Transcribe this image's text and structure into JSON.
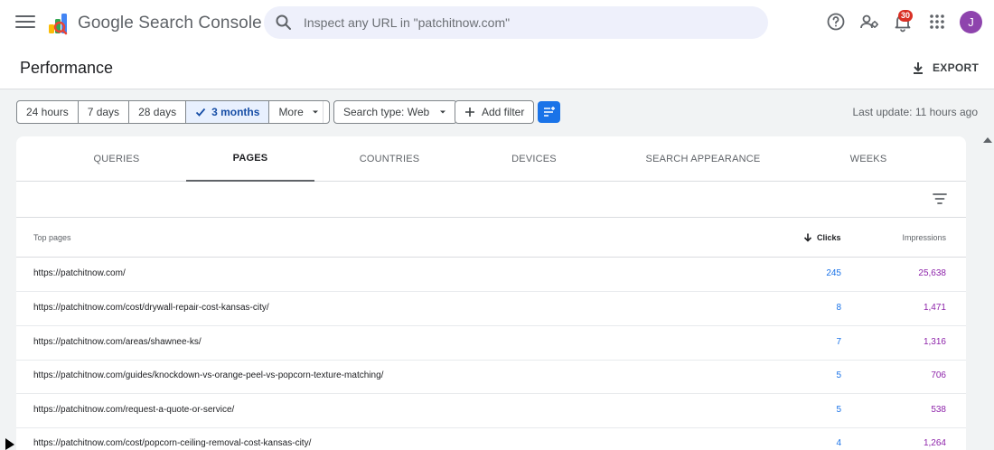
{
  "app": {
    "product_name": "Google Search Console",
    "search_placeholder": "Inspect any URL in \"patchitnow.com\"",
    "notification_count": "30",
    "avatar_initial": "J"
  },
  "header": {
    "title": "Performance",
    "export_label": "EXPORT"
  },
  "filters": {
    "date_ranges": [
      {
        "label": "24 hours",
        "selected": false
      },
      {
        "label": "7 days",
        "selected": false
      },
      {
        "label": "28 days",
        "selected": false
      },
      {
        "label": "3 months",
        "selected": true
      },
      {
        "label": "More",
        "selected": false
      }
    ],
    "search_type": "Search type: Web",
    "add_filter": "Add filter",
    "last_update": "Last update: 11 hours ago"
  },
  "tabs": [
    "QUERIES",
    "PAGES",
    "COUNTRIES",
    "DEVICES",
    "SEARCH APPEARANCE",
    "WEEKS"
  ],
  "active_tab": "PAGES",
  "table": {
    "columns": [
      "Top pages",
      "Clicks",
      "Impressions"
    ],
    "rows": [
      {
        "url": "https://patchitnow.com/",
        "clicks": "245",
        "impressions": "25,638"
      },
      {
        "url": "https://patchitnow.com/cost/drywall-repair-cost-kansas-city/",
        "clicks": "8",
        "impressions": "1,471"
      },
      {
        "url": "https://patchitnow.com/areas/shawnee-ks/",
        "clicks": "7",
        "impressions": "1,316"
      },
      {
        "url": "https://patchitnow.com/guides/knockdown-vs-orange-peel-vs-popcorn-texture-matching/",
        "clicks": "5",
        "impressions": "706"
      },
      {
        "url": "https://patchitnow.com/request-a-quote-or-service/",
        "clicks": "5",
        "impressions": "538"
      },
      {
        "url": "https://patchitnow.com/cost/popcorn-ceiling-removal-cost-kansas-city/",
        "clicks": "4",
        "impressions": "1,264"
      }
    ]
  },
  "colors": {
    "clicks": "#1a73e8",
    "impressions": "#8e24aa",
    "accent": "#1a73e8",
    "avatar": "#8e44ad"
  }
}
